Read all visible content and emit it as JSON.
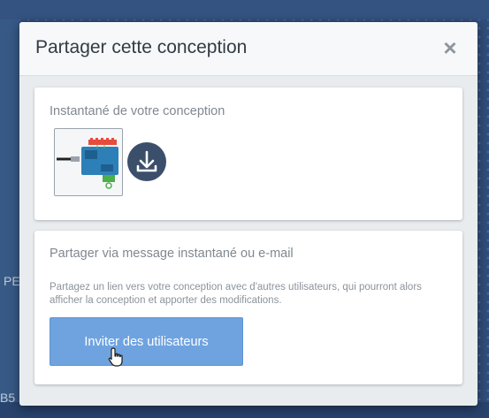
{
  "modal": {
    "title": "Partager cette conception",
    "close_symbol": "×",
    "snapshot": {
      "title": "Instantané de votre conception",
      "download_icon": "download-icon"
    },
    "share": {
      "title": "Partager via message instantané ou e-mail",
      "description": "Partagez un lien vers votre conception avec d'autres utilisateurs, qui pourront alors afficher la conception et apporter des modifications.",
      "invite_label": "Inviter des utilisateurs"
    }
  },
  "background": {
    "left_label_1": "PE",
    "left_label_2": "B5"
  },
  "colors": {
    "accent": "#6fa3e0",
    "download_bg": "#3b4f6b",
    "title_text": "#333b44"
  }
}
